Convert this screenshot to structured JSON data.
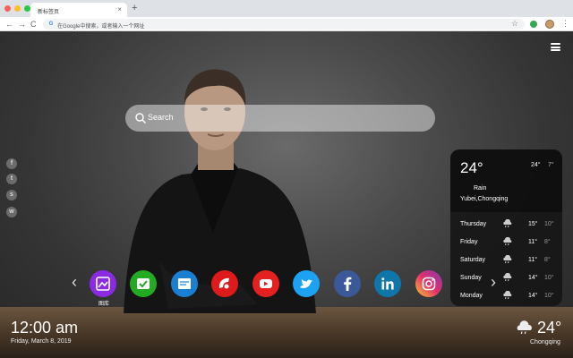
{
  "browser": {
    "tab_title": "新标签页",
    "tab_close": "×",
    "new_tab": "+",
    "back": "←",
    "forward": "→",
    "reload": "C",
    "google_glyph": "G",
    "address_placeholder": "在Google中搜索，或者输入一个网址",
    "star": "☆",
    "menu": "⋮",
    "colors": {
      "close": "#ff5f57",
      "min": "#febc2e",
      "max": "#28c840"
    }
  },
  "page": {
    "search": {
      "placeholder": "Search"
    },
    "social_links": [
      {
        "icon": "facebook-icon",
        "glyph": "f"
      },
      {
        "icon": "twitter-icon",
        "glyph": "t"
      },
      {
        "icon": "snapchat-icon",
        "glyph": "s"
      },
      {
        "icon": "wechat-icon",
        "glyph": "w"
      }
    ],
    "weather_card": {
      "temp": "24°",
      "high": "24°",
      "low": "7°",
      "condition": "Rain",
      "location": "Yubei,Chongqing",
      "forecast": [
        {
          "day": "Thursday",
          "high": "15°",
          "low": "10°"
        },
        {
          "day": "Friday",
          "high": "11°",
          "low": "8°"
        },
        {
          "day": "Saturday",
          "high": "11°",
          "low": "8°"
        },
        {
          "day": "Sunday",
          "high": "14°",
          "low": "10°"
        },
        {
          "day": "Monday",
          "high": "14°",
          "low": "10°"
        }
      ]
    },
    "apps": {
      "prev": "‹",
      "next": "›",
      "first_label": "图库",
      "items": [
        {
          "name": "gallery",
          "color": "#8a2be2"
        },
        {
          "name": "check",
          "color": "#22aa22"
        },
        {
          "name": "notes",
          "color": "#1a7fd0"
        },
        {
          "name": "game",
          "color": "#dd1b1b"
        },
        {
          "name": "youtube",
          "color": "#e52020"
        },
        {
          "name": "twitter",
          "color": "#1da1f2"
        },
        {
          "name": "facebook",
          "color": "#3b5998"
        },
        {
          "name": "linkedin",
          "color": "#0e76a8"
        },
        {
          "name": "instagram",
          "color": "#d6249f"
        }
      ]
    },
    "clock": {
      "time": "12:00 am",
      "date": "Friday, March 8, 2019"
    },
    "bottom_weather": {
      "temp": "24°",
      "city": "Chongqing"
    }
  }
}
